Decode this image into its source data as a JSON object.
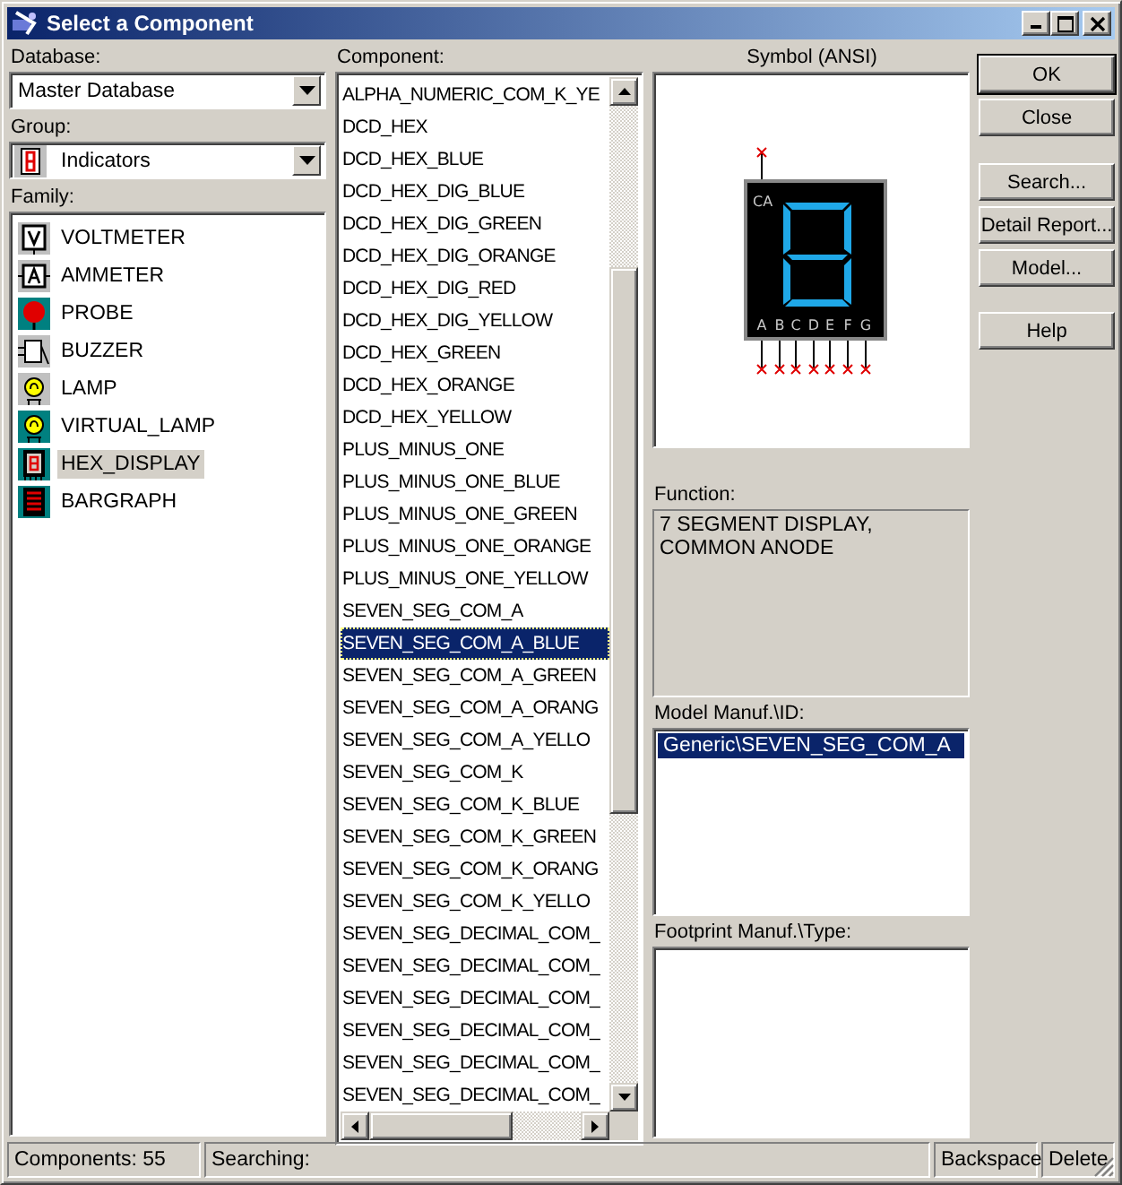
{
  "window": {
    "title": "Select a Component"
  },
  "database": {
    "label": "Database:",
    "value": "Master Database"
  },
  "group": {
    "label": "Group:",
    "value": "Indicators"
  },
  "family": {
    "label": "Family:",
    "items": [
      {
        "label": "VOLTMETER",
        "kind": "voltmeter",
        "selected": false
      },
      {
        "label": "AMMETER",
        "kind": "ammeter",
        "selected": false
      },
      {
        "label": "PROBE",
        "kind": "probe",
        "selected": false
      },
      {
        "label": "BUZZER",
        "kind": "buzzer",
        "selected": false
      },
      {
        "label": "LAMP",
        "kind": "lamp",
        "selected": false
      },
      {
        "label": "VIRTUAL_LAMP",
        "kind": "virtual_lamp",
        "selected": false
      },
      {
        "label": "HEX_DISPLAY",
        "kind": "hex_display",
        "selected": true
      },
      {
        "label": "BARGRAPH",
        "kind": "bargraph",
        "selected": false
      }
    ]
  },
  "component": {
    "label": "Component:",
    "items": [
      {
        "label": "ALPHA_NUMERIC_COM_K_YE",
        "selected": false
      },
      {
        "label": "DCD_HEX",
        "selected": false
      },
      {
        "label": "DCD_HEX_BLUE",
        "selected": false
      },
      {
        "label": "DCD_HEX_DIG_BLUE",
        "selected": false
      },
      {
        "label": "DCD_HEX_DIG_GREEN",
        "selected": false
      },
      {
        "label": "DCD_HEX_DIG_ORANGE",
        "selected": false
      },
      {
        "label": "DCD_HEX_DIG_RED",
        "selected": false
      },
      {
        "label": "DCD_HEX_DIG_YELLOW",
        "selected": false
      },
      {
        "label": "DCD_HEX_GREEN",
        "selected": false
      },
      {
        "label": "DCD_HEX_ORANGE",
        "selected": false
      },
      {
        "label": "DCD_HEX_YELLOW",
        "selected": false
      },
      {
        "label": "PLUS_MINUS_ONE",
        "selected": false
      },
      {
        "label": "PLUS_MINUS_ONE_BLUE",
        "selected": false
      },
      {
        "label": "PLUS_MINUS_ONE_GREEN",
        "selected": false
      },
      {
        "label": "PLUS_MINUS_ONE_ORANGE",
        "selected": false
      },
      {
        "label": "PLUS_MINUS_ONE_YELLOW",
        "selected": false
      },
      {
        "label": "SEVEN_SEG_COM_A",
        "selected": false
      },
      {
        "label": "SEVEN_SEG_COM_A_BLUE",
        "selected": true
      },
      {
        "label": "SEVEN_SEG_COM_A_GREEN",
        "selected": false
      },
      {
        "label": "SEVEN_SEG_COM_A_ORANG",
        "selected": false
      },
      {
        "label": "SEVEN_SEG_COM_A_YELLO",
        "selected": false
      },
      {
        "label": "SEVEN_SEG_COM_K",
        "selected": false
      },
      {
        "label": "SEVEN_SEG_COM_K_BLUE",
        "selected": false
      },
      {
        "label": "SEVEN_SEG_COM_K_GREEN",
        "selected": false
      },
      {
        "label": "SEVEN_SEG_COM_K_ORANG",
        "selected": false
      },
      {
        "label": "SEVEN_SEG_COM_K_YELLO",
        "selected": false
      },
      {
        "label": "SEVEN_SEG_DECIMAL_COM_",
        "selected": false
      },
      {
        "label": "SEVEN_SEG_DECIMAL_COM_",
        "selected": false
      },
      {
        "label": "SEVEN_SEG_DECIMAL_COM_",
        "selected": false
      },
      {
        "label": "SEVEN_SEG_DECIMAL_COM_",
        "selected": false
      },
      {
        "label": "SEVEN_SEG_DECIMAL_COM_",
        "selected": false
      },
      {
        "label": "SEVEN_SEG_DECIMAL_COM_",
        "selected": false
      }
    ]
  },
  "symbol": {
    "title": "Symbol (ANSI)",
    "common_pin": "CA",
    "pins": [
      "A",
      "B",
      "C",
      "D",
      "E",
      "F",
      "G"
    ]
  },
  "function": {
    "label": "Function:",
    "text": "7 SEGMENT DISPLAY, COMMON ANODE"
  },
  "model": {
    "label": "Model Manuf.\\ID:",
    "items": [
      {
        "label": "Generic\\SEVEN_SEG_COM_A",
        "selected": true
      }
    ]
  },
  "footprint": {
    "label": "Footprint Manuf.\\Type:"
  },
  "buttons": [
    {
      "label": "OK",
      "default": true
    },
    {
      "label": "Close",
      "default": false
    },
    {
      "label": "Search...",
      "default": false
    },
    {
      "label": "Detail Report...",
      "default": false
    },
    {
      "label": "Model...",
      "default": false
    },
    {
      "label": "Help",
      "default": false
    }
  ],
  "status_bar": [
    "Components: 55",
    "Searching:",
    "Backspace",
    "Delete"
  ]
}
